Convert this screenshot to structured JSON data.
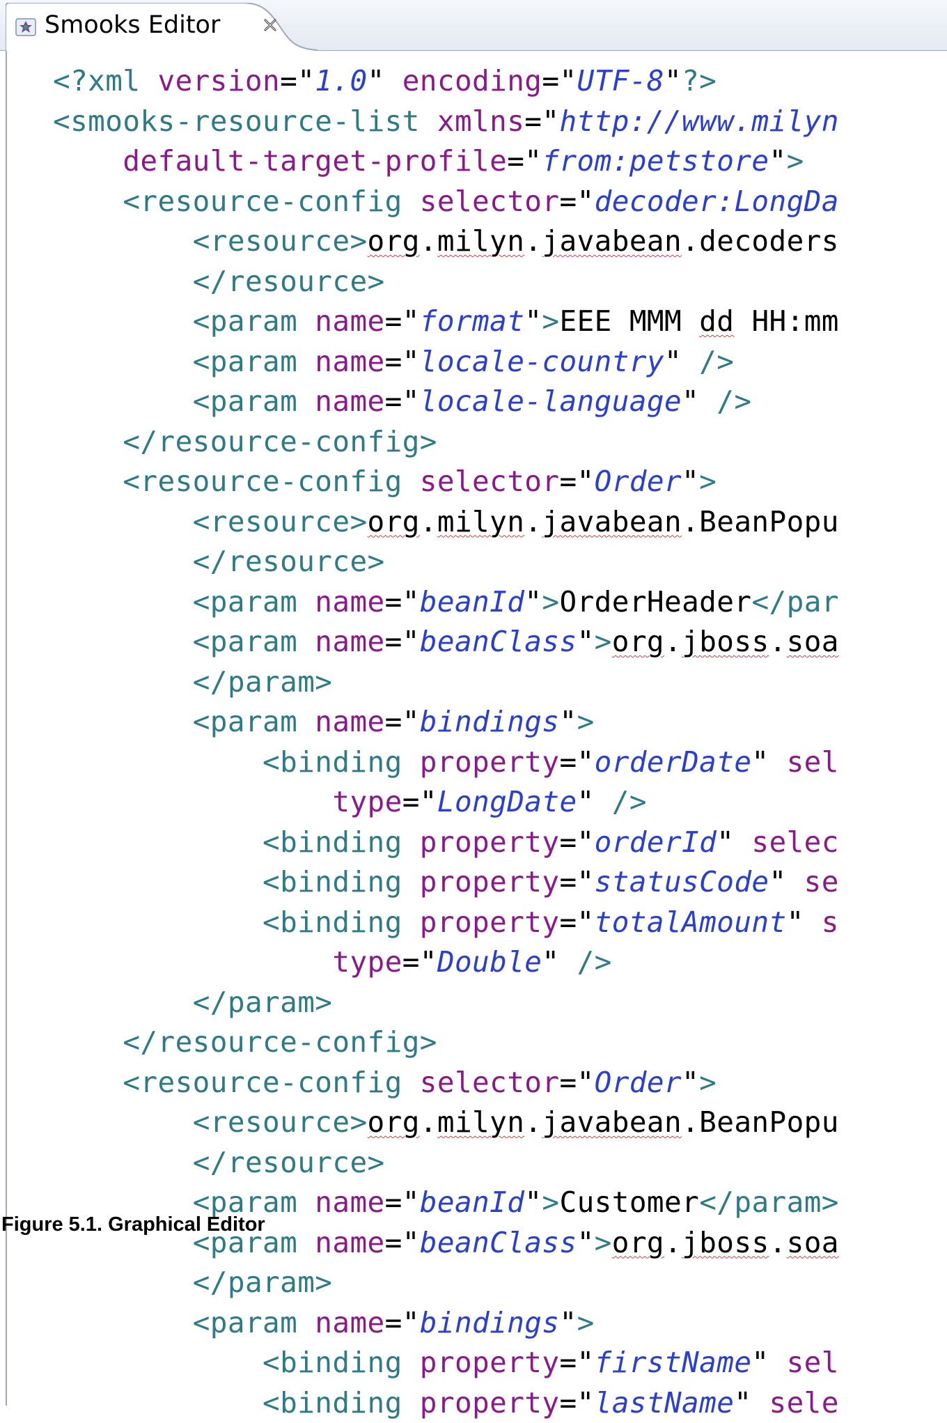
{
  "tab": {
    "title": "Smooks Editor",
    "icon": "smooks-icon",
    "close_icon": "close-icon"
  },
  "colors": {
    "tag": "#2e7b86",
    "attribute": "#8a1a8a",
    "value": "#2a3fd0",
    "text": "#000000",
    "spellcheck": "#d04040"
  },
  "code_lines": [
    {
      "indent": 0,
      "tokens": [
        {
          "t": "tag",
          "s": "<?xml "
        },
        {
          "t": "attr",
          "s": "version"
        },
        {
          "t": "plain",
          "s": "=\""
        },
        {
          "t": "val",
          "s": "1.0"
        },
        {
          "t": "plain",
          "s": "\" "
        },
        {
          "t": "attr",
          "s": "encoding"
        },
        {
          "t": "plain",
          "s": "=\""
        },
        {
          "t": "val",
          "s": "UTF-8"
        },
        {
          "t": "plain",
          "s": "\""
        },
        {
          "t": "tag",
          "s": "?>"
        }
      ]
    },
    {
      "indent": 0,
      "tokens": [
        {
          "t": "tag",
          "s": "<smooks-resource-list "
        },
        {
          "t": "attr",
          "s": "xmlns"
        },
        {
          "t": "plain",
          "s": "=\""
        },
        {
          "t": "val",
          "s": "http://www.milyn"
        }
      ]
    },
    {
      "indent": 1,
      "tokens": [
        {
          "t": "attr",
          "s": "default-target-profile"
        },
        {
          "t": "plain",
          "s": "=\""
        },
        {
          "t": "val",
          "s": "from:petstore"
        },
        {
          "t": "plain",
          "s": "\""
        },
        {
          "t": "tag",
          "s": ">"
        }
      ]
    },
    {
      "indent": 1,
      "tokens": [
        {
          "t": "tag",
          "s": "<resource-config "
        },
        {
          "t": "attr",
          "s": "selector"
        },
        {
          "t": "plain",
          "s": "=\""
        },
        {
          "t": "val",
          "s": "decoder:LongDa"
        }
      ]
    },
    {
      "indent": 2,
      "tokens": [
        {
          "t": "tag",
          "s": "<resource>"
        },
        {
          "t": "sp",
          "s": "org"
        },
        {
          "t": "plain",
          "s": "."
        },
        {
          "t": "sp",
          "s": "milyn"
        },
        {
          "t": "plain",
          "s": "."
        },
        {
          "t": "sp",
          "s": "javabean"
        },
        {
          "t": "plain",
          "s": ".decoders"
        }
      ]
    },
    {
      "indent": 2,
      "tokens": [
        {
          "t": "tag",
          "s": "</resource>"
        }
      ]
    },
    {
      "indent": 2,
      "tokens": [
        {
          "t": "tag",
          "s": "<param "
        },
        {
          "t": "attr",
          "s": "name"
        },
        {
          "t": "plain",
          "s": "=\""
        },
        {
          "t": "val",
          "s": "format"
        },
        {
          "t": "plain",
          "s": "\""
        },
        {
          "t": "tag",
          "s": ">"
        },
        {
          "t": "plain",
          "s": "EEE MMM "
        },
        {
          "t": "sp",
          "s": "dd"
        },
        {
          "t": "plain",
          "s": " HH:mm"
        }
      ]
    },
    {
      "indent": 2,
      "tokens": [
        {
          "t": "tag",
          "s": "<param "
        },
        {
          "t": "attr",
          "s": "name"
        },
        {
          "t": "plain",
          "s": "=\""
        },
        {
          "t": "val",
          "s": "locale-country"
        },
        {
          "t": "plain",
          "s": "\" "
        },
        {
          "t": "tag",
          "s": "/>"
        }
      ]
    },
    {
      "indent": 2,
      "tokens": [
        {
          "t": "tag",
          "s": "<param "
        },
        {
          "t": "attr",
          "s": "name"
        },
        {
          "t": "plain",
          "s": "=\""
        },
        {
          "t": "val",
          "s": "locale-language"
        },
        {
          "t": "plain",
          "s": "\" "
        },
        {
          "t": "tag",
          "s": "/>"
        }
      ]
    },
    {
      "indent": 1,
      "tokens": [
        {
          "t": "tag",
          "s": "</resource-config>"
        }
      ]
    },
    {
      "indent": 1,
      "tokens": [
        {
          "t": "tag",
          "s": "<resource-config "
        },
        {
          "t": "attr",
          "s": "selector"
        },
        {
          "t": "plain",
          "s": "=\""
        },
        {
          "t": "val",
          "s": "Order"
        },
        {
          "t": "plain",
          "s": "\""
        },
        {
          "t": "tag",
          "s": ">"
        }
      ]
    },
    {
      "indent": 2,
      "tokens": [
        {
          "t": "tag",
          "s": "<resource>"
        },
        {
          "t": "sp",
          "s": "org"
        },
        {
          "t": "plain",
          "s": "."
        },
        {
          "t": "sp",
          "s": "milyn"
        },
        {
          "t": "plain",
          "s": "."
        },
        {
          "t": "sp",
          "s": "javabean"
        },
        {
          "t": "plain",
          "s": ".BeanPopu"
        }
      ]
    },
    {
      "indent": 2,
      "tokens": [
        {
          "t": "tag",
          "s": "</resource>"
        }
      ]
    },
    {
      "indent": 2,
      "tokens": [
        {
          "t": "tag",
          "s": "<param "
        },
        {
          "t": "attr",
          "s": "name"
        },
        {
          "t": "plain",
          "s": "=\""
        },
        {
          "t": "val",
          "s": "beanId"
        },
        {
          "t": "plain",
          "s": "\""
        },
        {
          "t": "tag",
          "s": ">"
        },
        {
          "t": "plain",
          "s": "OrderHeader"
        },
        {
          "t": "tag",
          "s": "</par"
        }
      ]
    },
    {
      "indent": 2,
      "tokens": [
        {
          "t": "tag",
          "s": "<param "
        },
        {
          "t": "attr",
          "s": "name"
        },
        {
          "t": "plain",
          "s": "=\""
        },
        {
          "t": "val",
          "s": "beanClass"
        },
        {
          "t": "plain",
          "s": "\""
        },
        {
          "t": "tag",
          "s": ">"
        },
        {
          "t": "sp",
          "s": "org"
        },
        {
          "t": "plain",
          "s": "."
        },
        {
          "t": "sp",
          "s": "jboss"
        },
        {
          "t": "plain",
          "s": "."
        },
        {
          "t": "sp",
          "s": "soa"
        }
      ]
    },
    {
      "indent": 2,
      "tokens": [
        {
          "t": "tag",
          "s": "</param>"
        }
      ]
    },
    {
      "indent": 2,
      "tokens": [
        {
          "t": "tag",
          "s": "<param "
        },
        {
          "t": "attr",
          "s": "name"
        },
        {
          "t": "plain",
          "s": "=\""
        },
        {
          "t": "val",
          "s": "bindings"
        },
        {
          "t": "plain",
          "s": "\""
        },
        {
          "t": "tag",
          "s": ">"
        }
      ]
    },
    {
      "indent": 3,
      "tokens": [
        {
          "t": "tag",
          "s": "<binding "
        },
        {
          "t": "attr",
          "s": "property"
        },
        {
          "t": "plain",
          "s": "=\""
        },
        {
          "t": "val",
          "s": "orderDate"
        },
        {
          "t": "plain",
          "s": "\" "
        },
        {
          "t": "attr",
          "s": "sel"
        }
      ]
    },
    {
      "indent": 4,
      "tokens": [
        {
          "t": "attr",
          "s": "type"
        },
        {
          "t": "plain",
          "s": "=\""
        },
        {
          "t": "val",
          "s": "LongDate"
        },
        {
          "t": "plain",
          "s": "\" "
        },
        {
          "t": "tag",
          "s": "/>"
        }
      ]
    },
    {
      "indent": 3,
      "tokens": [
        {
          "t": "tag",
          "s": "<binding "
        },
        {
          "t": "attr",
          "s": "property"
        },
        {
          "t": "plain",
          "s": "=\""
        },
        {
          "t": "val",
          "s": "orderId"
        },
        {
          "t": "plain",
          "s": "\" "
        },
        {
          "t": "attr",
          "s": "selec"
        }
      ]
    },
    {
      "indent": 3,
      "tokens": [
        {
          "t": "tag",
          "s": "<binding "
        },
        {
          "t": "attr",
          "s": "property"
        },
        {
          "t": "plain",
          "s": "=\""
        },
        {
          "t": "val",
          "s": "statusCode"
        },
        {
          "t": "plain",
          "s": "\" "
        },
        {
          "t": "attr",
          "s": "se"
        }
      ]
    },
    {
      "indent": 3,
      "tokens": [
        {
          "t": "tag",
          "s": "<binding "
        },
        {
          "t": "attr",
          "s": "property"
        },
        {
          "t": "plain",
          "s": "=\""
        },
        {
          "t": "val",
          "s": "totalAmount"
        },
        {
          "t": "plain",
          "s": "\" "
        },
        {
          "t": "attr",
          "s": "s"
        }
      ]
    },
    {
      "indent": 4,
      "tokens": [
        {
          "t": "attr",
          "s": "type"
        },
        {
          "t": "plain",
          "s": "=\""
        },
        {
          "t": "val",
          "s": "Double"
        },
        {
          "t": "plain",
          "s": "\" "
        },
        {
          "t": "tag",
          "s": "/>"
        }
      ]
    },
    {
      "indent": 2,
      "tokens": [
        {
          "t": "tag",
          "s": "</param>"
        }
      ]
    },
    {
      "indent": 1,
      "tokens": [
        {
          "t": "tag",
          "s": "</resource-config>"
        }
      ]
    },
    {
      "indent": 1,
      "tokens": [
        {
          "t": "tag",
          "s": "<resource-config "
        },
        {
          "t": "attr",
          "s": "selector"
        },
        {
          "t": "plain",
          "s": "=\""
        },
        {
          "t": "val",
          "s": "Order"
        },
        {
          "t": "plain",
          "s": "\""
        },
        {
          "t": "tag",
          "s": ">"
        }
      ]
    },
    {
      "indent": 2,
      "tokens": [
        {
          "t": "tag",
          "s": "<resource>"
        },
        {
          "t": "sp",
          "s": "org"
        },
        {
          "t": "plain",
          "s": "."
        },
        {
          "t": "sp",
          "s": "milyn"
        },
        {
          "t": "plain",
          "s": "."
        },
        {
          "t": "sp",
          "s": "javabean"
        },
        {
          "t": "plain",
          "s": ".BeanPopu"
        }
      ]
    },
    {
      "indent": 2,
      "tokens": [
        {
          "t": "tag",
          "s": "</resource>"
        }
      ]
    },
    {
      "indent": 2,
      "tokens": [
        {
          "t": "tag",
          "s": "<param "
        },
        {
          "t": "attr",
          "s": "name"
        },
        {
          "t": "plain",
          "s": "=\""
        },
        {
          "t": "val",
          "s": "beanId"
        },
        {
          "t": "plain",
          "s": "\""
        },
        {
          "t": "tag",
          "s": ">"
        },
        {
          "t": "plain",
          "s": "Customer"
        },
        {
          "t": "tag",
          "s": "</param>"
        }
      ]
    },
    {
      "indent": 2,
      "tokens": [
        {
          "t": "tag",
          "s": "<param "
        },
        {
          "t": "attr",
          "s": "name"
        },
        {
          "t": "plain",
          "s": "=\""
        },
        {
          "t": "val",
          "s": "beanClass"
        },
        {
          "t": "plain",
          "s": "\""
        },
        {
          "t": "tag",
          "s": ">"
        },
        {
          "t": "sp",
          "s": "org"
        },
        {
          "t": "plain",
          "s": "."
        },
        {
          "t": "sp",
          "s": "jboss"
        },
        {
          "t": "plain",
          "s": "."
        },
        {
          "t": "sp",
          "s": "soa"
        }
      ]
    },
    {
      "indent": 2,
      "tokens": [
        {
          "t": "tag",
          "s": "</param>"
        }
      ]
    },
    {
      "indent": 2,
      "tokens": [
        {
          "t": "tag",
          "s": "<param "
        },
        {
          "t": "attr",
          "s": "name"
        },
        {
          "t": "plain",
          "s": "=\""
        },
        {
          "t": "val",
          "s": "bindings"
        },
        {
          "t": "plain",
          "s": "\""
        },
        {
          "t": "tag",
          "s": ">"
        }
      ]
    },
    {
      "indent": 3,
      "tokens": [
        {
          "t": "tag",
          "s": "<binding "
        },
        {
          "t": "attr",
          "s": "property"
        },
        {
          "t": "plain",
          "s": "=\""
        },
        {
          "t": "val",
          "s": "firstName"
        },
        {
          "t": "plain",
          "s": "\" "
        },
        {
          "t": "attr",
          "s": "sel"
        }
      ]
    },
    {
      "indent": 3,
      "tokens": [
        {
          "t": "tag",
          "s": "<binding "
        },
        {
          "t": "attr",
          "s": "property"
        },
        {
          "t": "plain",
          "s": "=\""
        },
        {
          "t": "val",
          "s": "lastName"
        },
        {
          "t": "plain",
          "s": "\" "
        },
        {
          "t": "attr",
          "s": "sele"
        }
      ]
    }
  ],
  "caption": "Figure 5.1. Graphical Editor"
}
